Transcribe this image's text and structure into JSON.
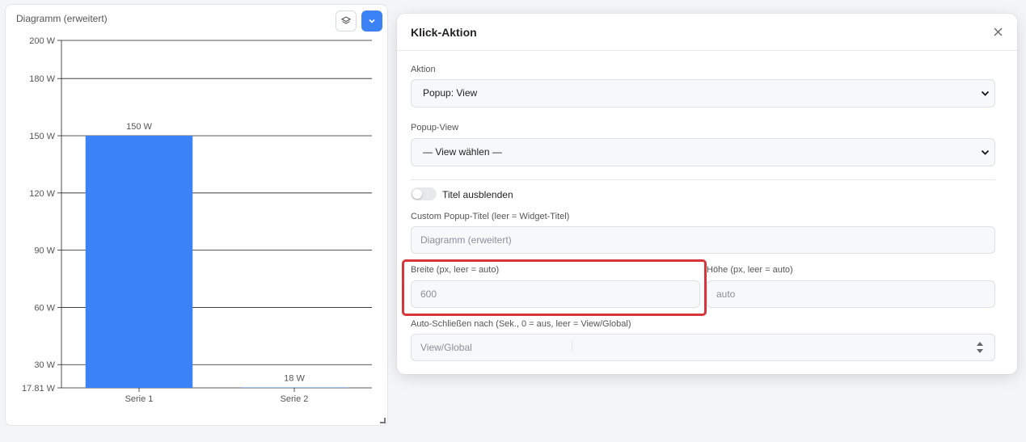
{
  "widget": {
    "title": "Diagramm (erweitert)",
    "icons": {
      "layers": "layers-icon",
      "expand": "chevron-down-icon"
    }
  },
  "chart_data": {
    "type": "bar",
    "categories": [
      "Serie 1",
      "Serie 2"
    ],
    "values": [
      150,
      18
    ],
    "value_labels": [
      "150 W",
      "18 W"
    ],
    "yticks": [
      17.81,
      30,
      60,
      90,
      120,
      150,
      180,
      200
    ],
    "ytick_labels": [
      "17.81 W",
      "30 W",
      "60 W",
      "90 W",
      "120 W",
      "150 W",
      "180 W",
      "200 W"
    ],
    "ylim": [
      17.81,
      200
    ],
    "unit": "W",
    "grid": true,
    "colors": [
      "#3b82f6",
      "#3b82f6"
    ]
  },
  "modal": {
    "title": "Klick-Aktion",
    "close_icon": "close-icon",
    "action_label": "Aktion",
    "action_value": "Popup: View",
    "popup_view_label": "Popup-View",
    "popup_view_value": "— View wählen —",
    "hide_title_label": "Titel ausblenden",
    "hide_title_on": false,
    "custom_title_label": "Custom Popup-Titel (leer = Widget-Titel)",
    "custom_title_placeholder": "Diagramm (erweitert)",
    "width_label": "Breite (px, leer = auto)",
    "width_placeholder": "600",
    "height_label": "Höhe (px, leer = auto)",
    "height_placeholder": "auto",
    "autoclose_label": "Auto-Schließen nach (Sek., 0 = aus, leer = View/Global)",
    "autoclose_placeholder": "View/Global"
  },
  "colors": {
    "accent": "#3b82f6",
    "highlight": "#d8353a"
  }
}
